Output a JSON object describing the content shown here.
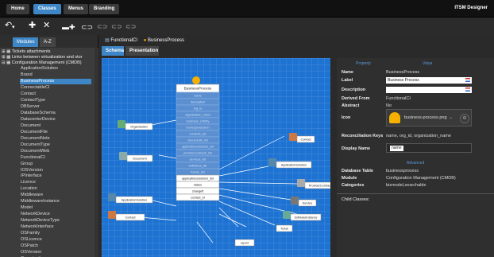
{
  "topbar": {
    "menus": [
      "Home",
      "Classes",
      "Menus",
      "Branding"
    ],
    "active_menu": "Classes",
    "app_title": "ITSM Designer"
  },
  "toolbar": {
    "icons": [
      "undo-icon",
      "add-icon",
      "delete-icon",
      "add-relation-icon",
      "relation-icon",
      "relation-icon",
      "relation-icon"
    ]
  },
  "left_panel": {
    "tabs": [
      "Modules",
      "A-Z"
    ],
    "active_tab": "Modules",
    "roots": [
      "Tickets attachments",
      "Links between virtualization and stor",
      "Configuration Management (CMDB)"
    ],
    "items": [
      "ApplicationSolution",
      "Brand",
      "BusinessProcess",
      "ConnectableCI",
      "Contact",
      "ContactType",
      "DBServer",
      "DatabaseSchema",
      "DatacenterDevice",
      "Document",
      "DocumentFile",
      "DocumentNote",
      "DocumentType",
      "DocumentWeb",
      "FunctionalCI",
      "Group",
      "IOSVersion",
      "IPInterface",
      "Licence",
      "Location",
      "Middleware",
      "MiddlewareInstance",
      "Model",
      "NetworkDevice",
      "NetworkDeviceType",
      "NetworkInterface",
      "OSFamily",
      "OSLicence",
      "OSPatch",
      "OSVersion",
      "Organization",
      "OtherSoftware"
    ],
    "selected_item": "BusinessProcess"
  },
  "main": {
    "breadcrumb": {
      "parent": "FunctionalCI",
      "current": "BusinessProcess"
    },
    "tabs": [
      "Schema",
      "Presentation"
    ],
    "active_tab": "Schema"
  },
  "diagram": {
    "class_title": "BusinessProcess",
    "attributes": [
      "name",
      "description",
      "org_id",
      "organization_name",
      "business_criticity",
      "move2production",
      "contacts_list",
      "documents_list",
      "applicationsolutions_list",
      "providercontracts_list",
      "services_list",
      "softwares_list",
      "tickets_list",
      "applicationsolutions_list",
      "status",
      "changeft",
      "contact_id"
    ],
    "nodes": {
      "organization": "Organization",
      "document": "Document",
      "contact_top": "Contact",
      "application_solution_right": "ApplicationSolution",
      "provider_contract": "ProviderContract",
      "service": "Service",
      "software_instance": "SoftwareInstance",
      "ticket": "Ticket",
      "application_solution_left": "ApplicationSolution",
      "contact_left": "Contact",
      "report": "report"
    }
  },
  "properties": {
    "headers": {
      "property": "Property",
      "value": "Value",
      "advanced": "Advanced"
    },
    "rows": [
      {
        "label": "Name",
        "value": "BusinessProcess"
      },
      {
        "label": "Label",
        "value": "Business Process"
      },
      {
        "label": "Description",
        "value": ""
      },
      {
        "label": "Derived From",
        "value": "FunctionalCI"
      },
      {
        "label": "Abstract",
        "value": "No"
      }
    ],
    "icon_label": "Icon",
    "icon_file": "business-process.png",
    "reconciliation_keys_label": "Reconciliation Keys",
    "reconciliation_keys": "name, org_id, organization_name",
    "display_name_label": "Display Name",
    "display_name_chip": "name",
    "advanced_rows": [
      {
        "label": "Database Table",
        "value": "businessprocess"
      },
      {
        "label": "Module",
        "value": "Configuration Management (CMDB)"
      },
      {
        "label": "Categories",
        "value": "bizmodel,searchable"
      }
    ],
    "child_classes_label": "Child Classes:"
  },
  "colors": {
    "accent": "#3e86c6",
    "diagram_bg": "#1e73d2",
    "header_blue": "#5a9ad8"
  }
}
